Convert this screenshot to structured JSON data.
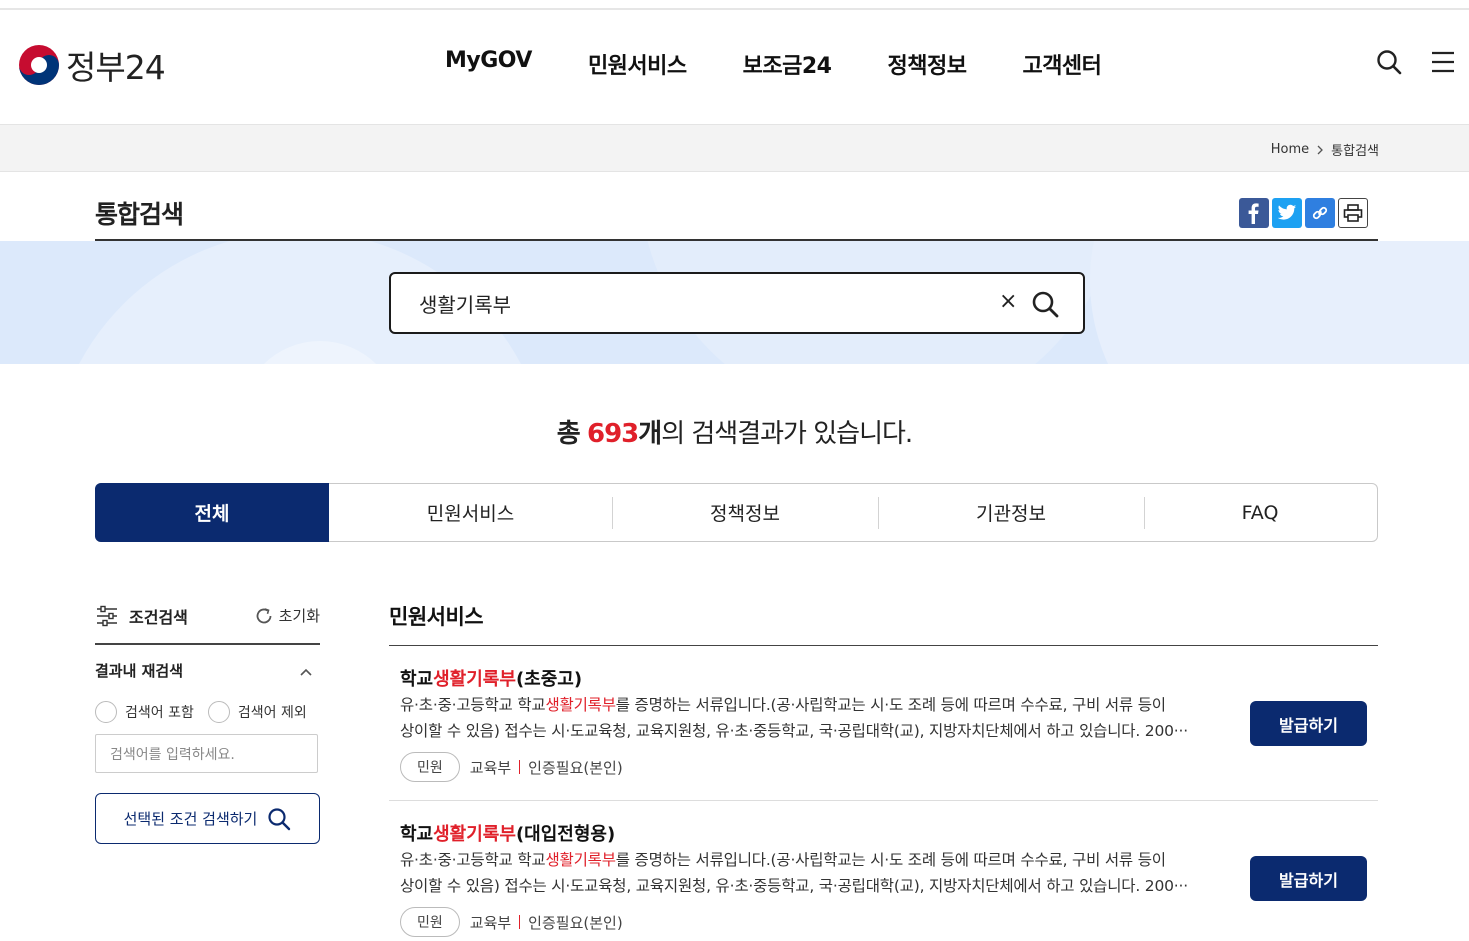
{
  "header": {
    "logo_text": "정부24",
    "nav": [
      "MyGOV",
      "민원서비스",
      "보조금24",
      "정책정보",
      "고객센터"
    ]
  },
  "breadcrumb": {
    "home": "Home",
    "current": "통합검색"
  },
  "page_title": "통합검색",
  "search": {
    "value": "생활기록부",
    "clear_label": "×"
  },
  "result": {
    "prefix": "총",
    "count": "693",
    "unit": "개",
    "suffix": "의 검색결과가 있습니다."
  },
  "tabs": [
    "전체",
    "민원서비스",
    "정책정보",
    "기관정보",
    "FAQ"
  ],
  "sidebar": {
    "title": "조건검색",
    "reset": "초기화",
    "refine_title": "결과내 재검색",
    "include": "검색어 포함",
    "exclude": "검색어 제외",
    "input_placeholder": "검색어를 입력하세요.",
    "submit": "선택된 조건 검색하기"
  },
  "section_title": "민원서비스",
  "items": [
    {
      "title_pre": "학교",
      "title_hl": "생활기록부",
      "title_post": "(초중고)",
      "desc_pre": "유·초·중·고등학교 학교",
      "desc_hl": "생활기록부",
      "desc_post": "를 증명하는 서류입니다.(공·사립학교는 시·도 조례 등에 따르며 수수료, 구비 서류 등이",
      "desc_line2": "상이할 수 있음) 접수는 시·도교육청, 교육지원청, 유·초·중등학교, 국·공립대학(교), 지방자치단체에서 하고 있습니다. 200···",
      "tag": "민원",
      "org": "교육부",
      "auth": "인증필요(본인)",
      "button": "발급하기"
    },
    {
      "title_pre": "학교",
      "title_hl": "생활기록부",
      "title_post": "(대입전형용)",
      "desc_pre": "유·초·중·고등학교 학교",
      "desc_hl": "생활기록부",
      "desc_post": "를 증명하는 서류입니다.(공·사립학교는 시·도 조례 등에 따르며 수수료, 구비 서류 등이",
      "desc_line2": "상이할 수 있음) 접수는 시·도교육청, 교육지원청, 유·초·중등학교, 국·공립대학(교), 지방자치단체에서 하고 있습니다. 200···",
      "tag": "민원",
      "org": "교육부",
      "auth": "인증필요(본인)",
      "button": "발급하기"
    }
  ],
  "colors": {
    "navy": "#0b2a6f",
    "highlight": "#e0202a",
    "band": "#dce9fb"
  }
}
